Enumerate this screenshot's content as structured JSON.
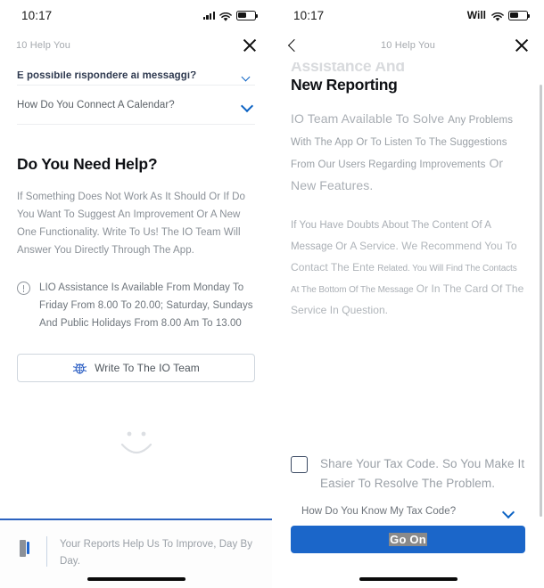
{
  "left": {
    "status": {
      "time": "10:17",
      "carrier": "",
      "battery_level": "52"
    },
    "nav": {
      "title": "10 Help You",
      "close_icon": "close-icon"
    },
    "faq": [
      {
        "question": "È possibile rispondere ai messaggi?",
        "chevron": "chevron-down-icon"
      },
      {
        "question": "How Do You Connect A Calendar?",
        "chevron": "chevron-down-icon"
      }
    ],
    "section_title": "Do You Need Help?",
    "paragraph": "If Something Does Not Work As It Should Or If Do You Want To Suggest An Improvement Or A New One Functionality. Write To Us! The IO Team Will Answer You Directly Through The App.",
    "notice": {
      "icon": "info-circle-icon",
      "text": "LIO Assistance Is Available From Monday To Friday From 8.00 To 20.00; Saturday, Sundays And Public Holidays From 8.00 Am To 13.00"
    },
    "write_button": {
      "label": "Write To The IO Team",
      "icon": "bug-icon"
    },
    "smiley": "smiley-face-icon",
    "banner": {
      "icon": "book-icon",
      "text": "Your Reports Help Us To Improve, Day By Day."
    }
  },
  "right": {
    "status": {
      "time": "10:17",
      "carrier": "Will",
      "battery_level": "52"
    },
    "nav": {
      "title": "10 Help You",
      "back_icon": "chevron-left-icon",
      "close_icon": "close-icon"
    },
    "ghost_title": "Assistance And",
    "title": "New Reporting",
    "subtitle_big": "IO Team Available To Solve",
    "subtitle_small": "Any Problems With The App Or To Listen To The Suggestions From Our Users Regarding Improvements",
    "subtitle_big2": "Or New Features.",
    "paragraph_1": "If You Have Doubts About The Content Of A Message Or",
    "paragraph_2": "A Service. We Recommend You To Contact The Ente",
    "paragraph_3": "Related. You Will Find The Contacts At The Bottom Of The Message",
    "paragraph_4": "Or In The Card Of The Service In Question.",
    "checkbox": {
      "checked": "false",
      "label": "Share Your Tax Code. So You Make It Easier To Resolve The Problem."
    },
    "helper": {
      "text": "How Do You Know My Tax Code?",
      "chevron": "chevron-down-icon"
    },
    "cta": {
      "label": "Go On"
    }
  },
  "colors": {
    "accent_blue": "#1b66c9",
    "chevron_blue": "#0d63c4",
    "muted_text": "#9aa0a7",
    "banner_border": "#2b62bf"
  }
}
